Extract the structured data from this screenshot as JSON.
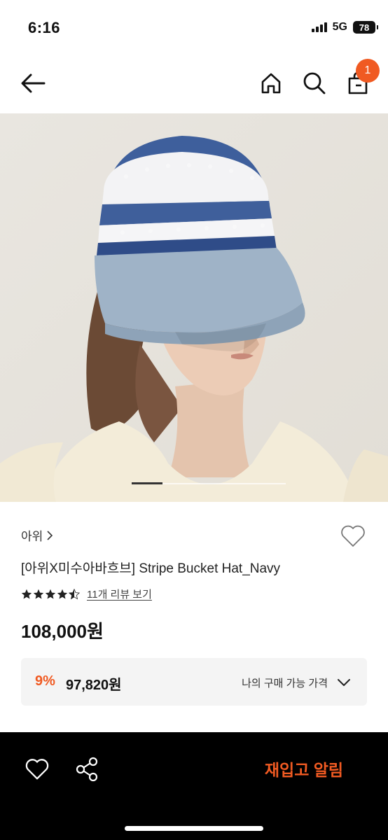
{
  "status_bar": {
    "time": "6:16",
    "network": "5G",
    "battery": "78"
  },
  "header": {
    "cart_count": "1"
  },
  "gallery": {
    "current_slide_fraction": 0.2
  },
  "product": {
    "brand": "아위",
    "name": "[아위X미수아바흐브] Stripe Bucket Hat_Navy",
    "rating": 4.5,
    "review_link": "11개 리뷰 보기",
    "price": "108,000원",
    "member_discount": "9%",
    "member_price": "97,820원",
    "member_price_label": "나의 구매 가능 가격"
  },
  "bottom_bar": {
    "restock_label": "재입고 알림"
  },
  "colors": {
    "accent": "#f05a22",
    "bottom_bar": "#000000"
  },
  "icons": [
    "back-arrow-icon",
    "home-icon",
    "search-icon",
    "cart-icon",
    "heart-icon",
    "star-icon",
    "chevron-down-icon",
    "share-icon",
    "chevron-right-icon"
  ]
}
